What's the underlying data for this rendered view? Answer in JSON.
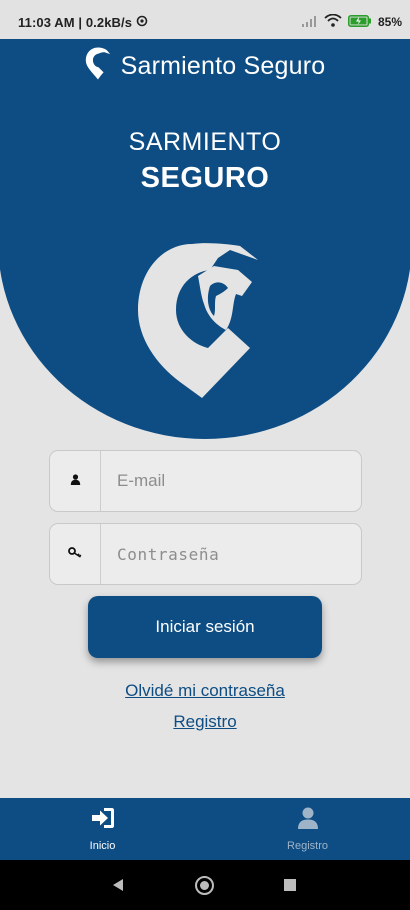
{
  "status_bar": {
    "time_speed": "11:03 AM | 0.2kB/s",
    "battery": "85"
  },
  "app_bar": {
    "title": "Sarmiento Seguro"
  },
  "hero": {
    "line1": "SARMIENTO",
    "line2": "SEGURO"
  },
  "login": {
    "email_placeholder": "E-mail",
    "password_placeholder": "Contraseña",
    "submit_label": "Iniciar sesión",
    "forgot_label": "Olvidé mi contraseña",
    "register_label": "Registro"
  },
  "bottom_nav": {
    "items": [
      {
        "label": "Inicio",
        "icon": "login-icon",
        "active": true
      },
      {
        "label": "Registro",
        "icon": "user-icon",
        "active": false
      }
    ]
  },
  "colors": {
    "brand": "#0e4d83",
    "background": "#e4e4e4"
  }
}
